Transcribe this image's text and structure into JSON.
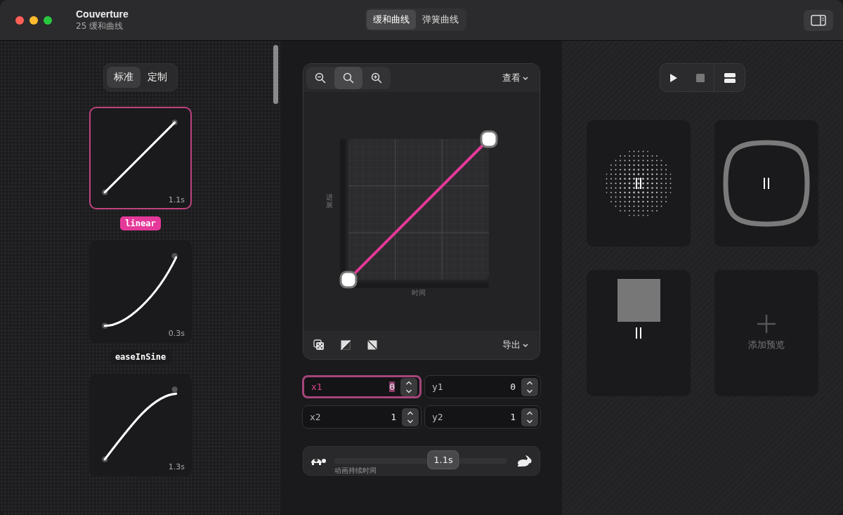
{
  "window": {
    "title": "Couverture",
    "subtitle": "25 缓和曲线"
  },
  "tabs": [
    {
      "label": "缓和曲线",
      "selected": true
    },
    {
      "label": "弹簧曲线",
      "selected": false
    }
  ],
  "sidebar": {
    "segments": [
      {
        "label": "标准",
        "selected": true
      },
      {
        "label": "定制",
        "selected": false
      }
    ],
    "curves": [
      {
        "name": "linear",
        "kind": "linear",
        "duration": "1.1s",
        "selected": true
      },
      {
        "name": "easeInSine",
        "kind": "ease-in",
        "duration": "0.3s",
        "selected": false
      },
      {
        "kind": "ease-out",
        "duration": "1.3s",
        "selected": false
      }
    ]
  },
  "editor": {
    "zoom_tools": [
      {
        "kind": "zoom-out",
        "selected": false
      },
      {
        "kind": "zoom-reset",
        "selected": true
      },
      {
        "kind": "zoom-in",
        "selected": false
      }
    ],
    "view_menu": "查看",
    "x_axis": "时间",
    "y_axis": "进展",
    "bottom_tools": [
      {
        "kind": "dice"
      },
      {
        "kind": "diagonal-up"
      },
      {
        "kind": "diagonal-down"
      }
    ],
    "export_menu": "导出",
    "fields": [
      {
        "label": "x1",
        "value": "0",
        "focused": true
      },
      {
        "label": "y1",
        "value": "0",
        "focused": false
      },
      {
        "label": "x2",
        "value": "1",
        "focused": false
      },
      {
        "label": "y2",
        "value": "1",
        "focused": false
      }
    ],
    "duration": {
      "label": "动画持续时间",
      "value": "1.1s",
      "level": 0.63
    }
  },
  "preview": {
    "controls": [
      {
        "kind": "play"
      },
      {
        "kind": "stop"
      },
      {
        "kind": "layout"
      }
    ],
    "cards": [
      {
        "kind": "dots",
        "paused": true
      },
      {
        "kind": "squircle",
        "paused": true
      },
      {
        "kind": "square",
        "paused": true
      },
      {
        "kind": "add",
        "label": "添加预览"
      }
    ]
  }
}
